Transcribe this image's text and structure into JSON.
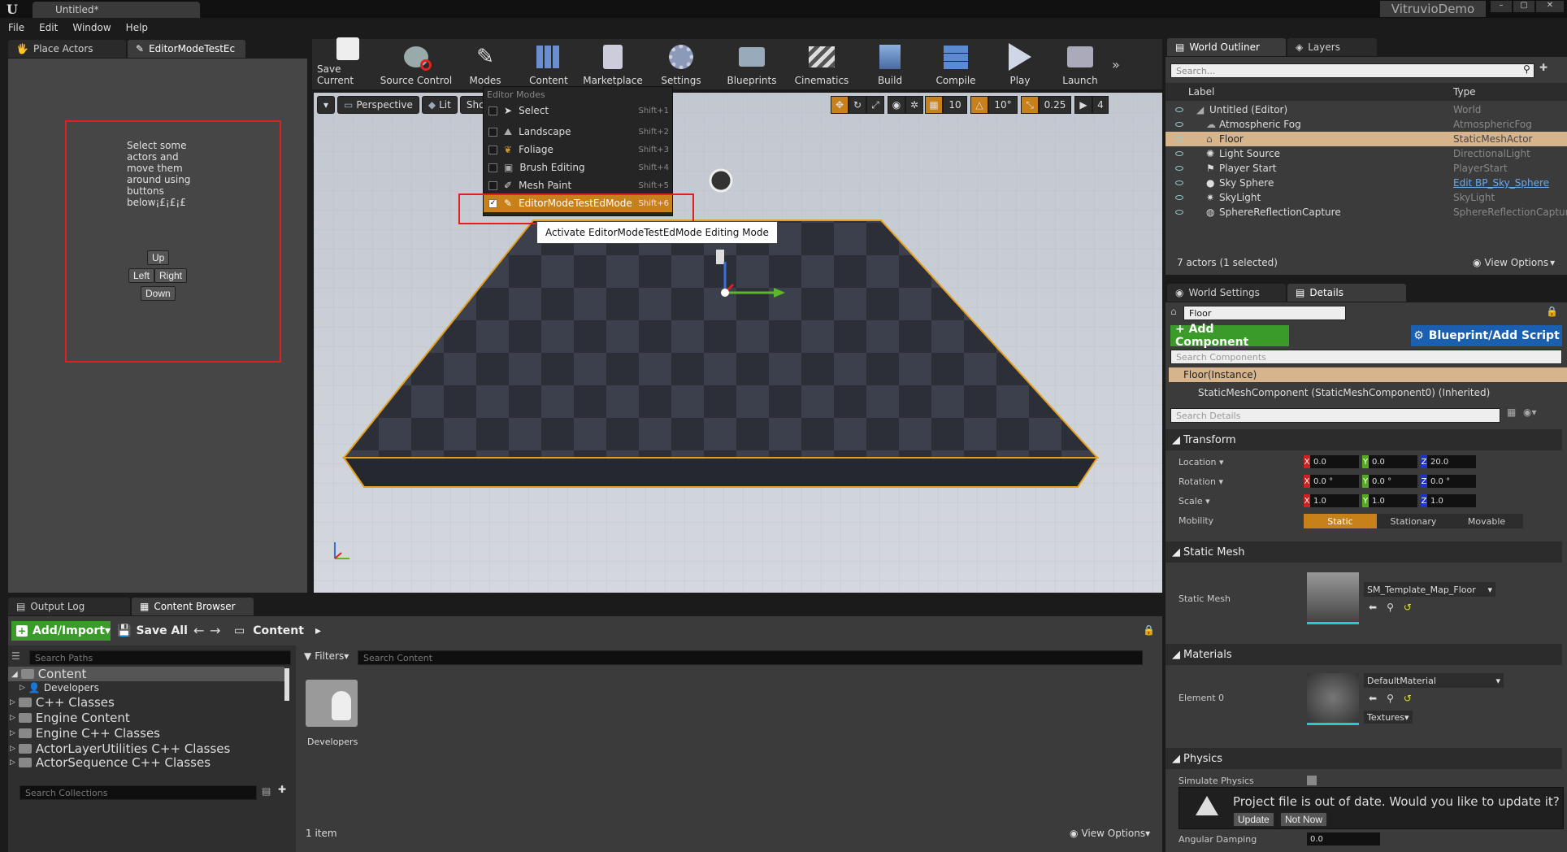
{
  "title_bar": {
    "tab": "Untitled*",
    "project": "VitruvioDemo"
  },
  "menu": [
    "File",
    "Edit",
    "Window",
    "Help"
  ],
  "left_tabs": [
    "Place Actors",
    "EditorModeTestEc"
  ],
  "mode_panel": {
    "text": "Select some actors and move them around using buttons below¡£¡£¡£",
    "up": "Up",
    "left": "Left",
    "right": "Right",
    "down": "Down"
  },
  "toolbar": [
    {
      "label": "Save Current",
      "icon": "save-icon"
    },
    {
      "label": "Source Control",
      "icon": "source-control-icon"
    },
    {
      "label": "Modes",
      "icon": "modes-icon"
    },
    {
      "label": "Content",
      "icon": "content-icon"
    },
    {
      "label": "Marketplace",
      "icon": "marketplace-icon"
    },
    {
      "label": "Settings",
      "icon": "settings-icon"
    },
    {
      "label": "Blueprints",
      "icon": "blueprints-icon"
    },
    {
      "label": "Cinematics",
      "icon": "cinematics-icon"
    },
    {
      "label": "Build",
      "icon": "build-icon"
    },
    {
      "label": "Compile",
      "icon": "compile-icon"
    },
    {
      "label": "Play",
      "icon": "play-icon"
    },
    {
      "label": "Launch",
      "icon": "launch-icon"
    }
  ],
  "viewport": {
    "perspective": "Perspective",
    "lit": "Lit",
    "show": "Sho",
    "grid_snap": "10",
    "rot_snap": "10°",
    "scale_snap": "0.25",
    "cam_speed": "4"
  },
  "modes_menu": {
    "header": "Editor Modes",
    "items": [
      {
        "label": "Select",
        "shortcut": "Shift+1",
        "checked": false
      },
      {
        "label": "Landscape",
        "shortcut": "Shift+2",
        "checked": false
      },
      {
        "label": "Foliage",
        "shortcut": "Shift+3",
        "checked": false
      },
      {
        "label": "Brush Editing",
        "shortcut": "Shift+4",
        "checked": false
      },
      {
        "label": "Mesh Paint",
        "shortcut": "Shift+5",
        "checked": false
      },
      {
        "label": "EditorModeTestEdMode",
        "shortcut": "Shift+6",
        "checked": true
      }
    ],
    "tooltip": "Activate EditorModeTestEdMode Editing Mode"
  },
  "outliner": {
    "tabs": [
      "World Outliner",
      "Layers"
    ],
    "search_placeholder": "Search...",
    "col_label": "Label",
    "col_type": "Type",
    "rows": [
      {
        "label": "Untitled (Editor)",
        "type": "World",
        "indent": 1
      },
      {
        "label": "Atmospheric Fog",
        "type": "AtmosphericFog",
        "indent": 2
      },
      {
        "label": "Floor",
        "type": "StaticMeshActor",
        "indent": 2,
        "selected": true
      },
      {
        "label": "Light Source",
        "type": "DirectionalLight",
        "indent": 2
      },
      {
        "label": "Player Start",
        "type": "PlayerStart",
        "indent": 2
      },
      {
        "label": "Sky Sphere",
        "type": "Edit BP_Sky_Sphere",
        "indent": 2,
        "link": true
      },
      {
        "label": "SkyLight",
        "type": "SkyLight",
        "indent": 2
      },
      {
        "label": "SphereReflectionCapture",
        "type": "SphereReflectionCapture",
        "indent": 2
      }
    ],
    "footer": "7 actors (1 selected)",
    "view_options": "View Options"
  },
  "details": {
    "tabs": [
      "World Settings",
      "Details"
    ],
    "name": "Floor",
    "add_component": "+ Add Component",
    "blueprint": "Blueprint/Add Script",
    "search_components": "Search Components",
    "instance": "Floor(Instance)",
    "component": "StaticMeshComponent (StaticMeshComponent0) (Inherited)",
    "search_details": "Search Details",
    "transform": "Transform",
    "location": {
      "label": "Location",
      "x": "0.0",
      "y": "0.0",
      "z": "20.0"
    },
    "rotation": {
      "label": "Rotation",
      "x": "0.0 °",
      "y": "0.0 °",
      "z": "0.0 °"
    },
    "scale": {
      "label": "Scale",
      "x": "1.0",
      "y": "1.0",
      "z": "1.0"
    },
    "mobility": {
      "label": "Mobility",
      "static": "Static",
      "stationary": "Stationary",
      "movable": "Movable"
    },
    "static_mesh_section": "Static Mesh",
    "static_mesh_label": "Static Mesh",
    "static_mesh_value": "SM_Template_Map_Floor",
    "materials_section": "Materials",
    "element0": "Element 0",
    "material_value": "DefaultMaterial",
    "textures": "Textures",
    "physics_section": "Physics",
    "simulate_physics": "Simulate Physics",
    "angular_damping": "Angular Damping",
    "angular_value": "0.0"
  },
  "notification": {
    "text": "Project file is out of date. Would you like to update it?",
    "update": "Update",
    "not_now": "Not Now"
  },
  "bottom_tabs": [
    "Output Log",
    "Content Browser"
  ],
  "content_browser": {
    "add_import": "Add/Import",
    "save_all": "Save All",
    "path": "Content",
    "search_paths": "Search Paths",
    "filters": "Filters",
    "search_content": "Search Content",
    "tree": [
      "Content",
      "Developers",
      "C++ Classes",
      "Engine Content",
      "Engine C++ Classes",
      "ActorLayerUtilities C++ Classes",
      "ActorSequence C++ Classes"
    ],
    "search_collections": "Search Collections",
    "folder": "Developers",
    "count": "1 item",
    "view_options": "View Options"
  }
}
